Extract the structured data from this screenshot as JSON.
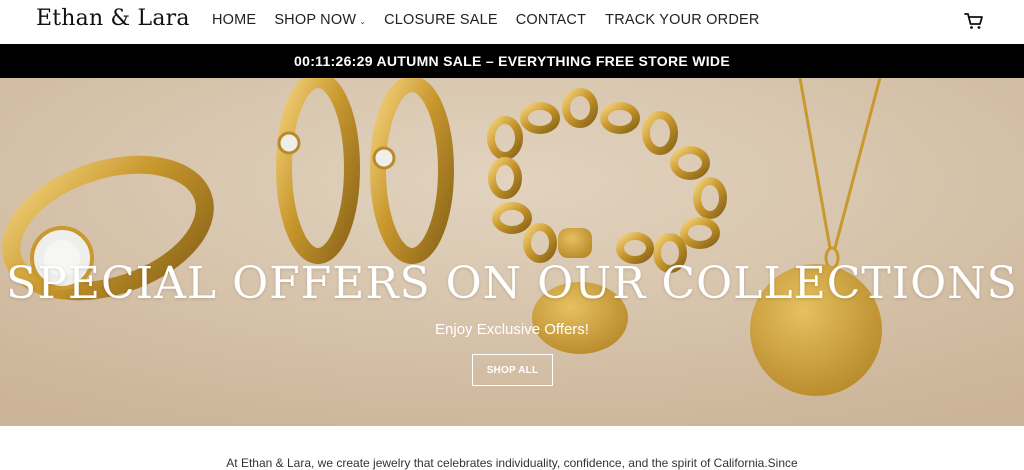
{
  "brand": {
    "name": "Ethan & Lara"
  },
  "nav": {
    "home": "HOME",
    "shop_now": "SHOP NOW",
    "closure_sale": "CLOSURE SALE",
    "contact": "CONTACT",
    "track_order": "TRACK YOUR ORDER"
  },
  "announcement": {
    "text": "00:11:26:29 AUTUMN SALE – EVERYTHING FREE STORE WIDE"
  },
  "hero": {
    "title": "SPECIAL OFFERS ON OUR COLLECTIONS",
    "subtitle": "Enjoy Exclusive Offers!",
    "cta_label": "SHOP ALL"
  },
  "intro": {
    "text": "At Ethan & Lara, we create jewelry that celebrates individuality, confidence, and the spirit of California.Since"
  },
  "icons": {
    "cart": "cart-icon",
    "dropdown": "chevron-down-icon"
  },
  "colors": {
    "announcement_bg": "#000000",
    "hero_bg": "#d6c3aa",
    "gold": "#c9982e"
  }
}
